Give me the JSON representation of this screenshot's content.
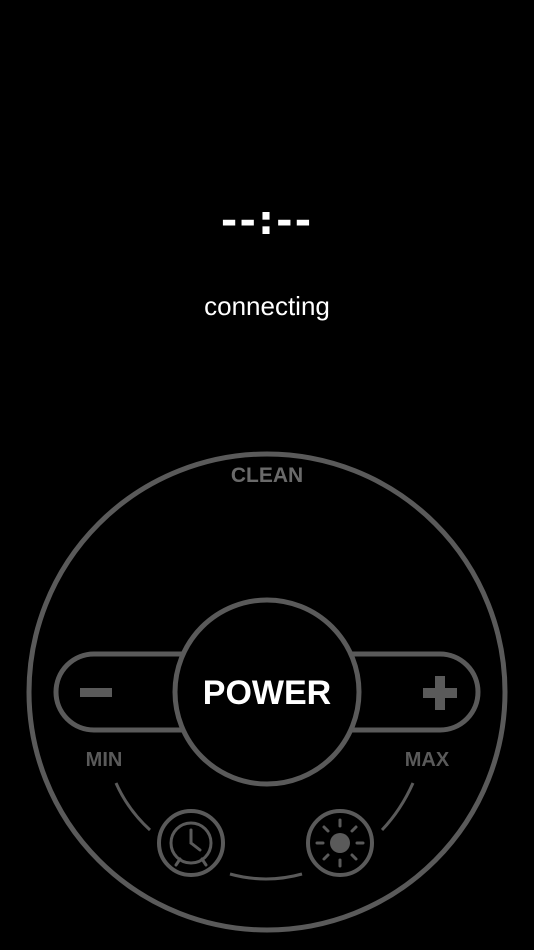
{
  "display": {
    "time": "--:--",
    "status": "connecting"
  },
  "remote": {
    "clean_label": "CLEAN",
    "power_label": "POWER",
    "min_label": "MIN",
    "max_label": "MAX",
    "minus_icon": "minus-icon",
    "plus_icon": "plus-icon",
    "timer_icon": "clock-icon",
    "light_icon": "sun-icon"
  },
  "colors": {
    "background": "#000000",
    "text": "#ffffff",
    "control_gray": "#5a5a5a",
    "label_gray": "#6a6a6a"
  }
}
